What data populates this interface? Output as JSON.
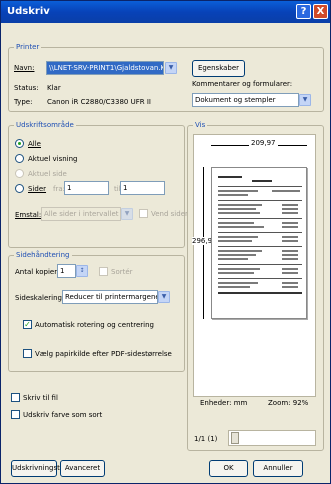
{
  "window": {
    "title": "Udskriv",
    "help": "?",
    "close": "X"
  },
  "printer": {
    "group_title": "Printer",
    "name_label": "Navn:",
    "name_value": "\\\\LNET-SRV-PRINT1\\Gjaldstovan.Kina.1",
    "properties_button": "Egenskaber",
    "status_label": "Status:",
    "status_value": "Klar",
    "type_label": "Type:",
    "type_value": "Canon iR C2880/C3380 UFR II",
    "comments_label": "Kommentarer og formularer:",
    "comments_value": "Dokument og stempler"
  },
  "range": {
    "group_title": "Udskriftsområde",
    "all": "Alle",
    "current_view": "Aktuel visning",
    "current_page": "Aktuel side",
    "pages": "Sider",
    "from_label": "fra:",
    "from_value": "1",
    "to_label": "til:",
    "to_value": "1",
    "subset_label": "Emstal:",
    "subset_value": "Alle sider i intervallet",
    "reverse": "Vend sider"
  },
  "handling": {
    "group_title": "Sidehåndtering",
    "copies_label": "Antal kopier:",
    "copies_value": "1",
    "collate": "Sortér",
    "scaling_label": "Sideskalering:",
    "scaling_value": "Reducer til printermargener",
    "auto_rotate": "Automatisk rotering og centrering",
    "choose_paper": "Vælg papirkilde efter PDF-sidestørrelse"
  },
  "options": {
    "print_to_file": "Skriv til fil",
    "print_color_black": "Udskriv farve som sort"
  },
  "preview": {
    "group_title": "Vis",
    "width": "209,97",
    "height": "296,93",
    "units": "Enheder: mm",
    "zoom": "Zoom: 92%",
    "page_counter": "1/1 (1)"
  },
  "footer": {
    "tips": "Udskrivningstip",
    "advanced": "Avanceret",
    "ok": "OK",
    "cancel": "Annuller"
  },
  "colors": {
    "title_bar": "#0842b8",
    "accent": "#21a121"
  }
}
